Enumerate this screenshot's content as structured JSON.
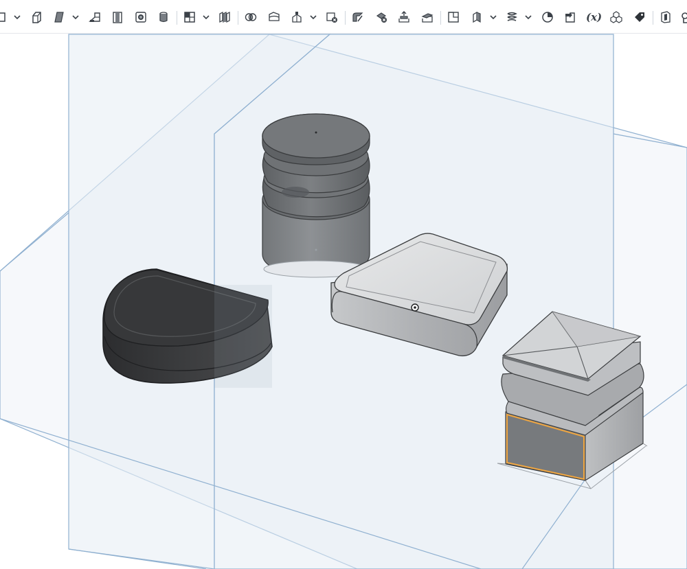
{
  "toolbar": {
    "items": [
      {
        "name": "sketch-tool",
        "icon": "sketch-icon"
      },
      {
        "name": "extrude-tool",
        "icon": "extrude-icon"
      },
      {
        "name": "revolve-tool",
        "icon": "revolve-icon"
      },
      {
        "name": "sweep-tool",
        "icon": "sweep-icon"
      },
      {
        "name": "loft-tool",
        "icon": "loft-icon"
      },
      {
        "name": "thicken-tool",
        "icon": "thicken-icon"
      },
      {
        "name": "enclose-tool",
        "icon": "enclose-icon"
      },
      {
        "name": "fillet-tool",
        "icon": "fillet-icon"
      },
      {
        "name": "chamfer-tool",
        "icon": "chamfer-icon"
      },
      {
        "name": "draft-tool",
        "icon": "draft-icon"
      },
      {
        "name": "rib-tool",
        "icon": "rib-icon"
      },
      {
        "name": "shell-tool",
        "icon": "shell-icon"
      },
      {
        "name": "hole-tool",
        "icon": "hole-icon"
      },
      {
        "name": "boolean-tool",
        "icon": "boolean-icon"
      },
      {
        "name": "split-tool",
        "icon": "split-icon"
      },
      {
        "name": "transform-tool",
        "icon": "transform-icon"
      },
      {
        "name": "delete-part-tool",
        "icon": "delete-part-icon"
      },
      {
        "name": "modify-fillet-tool",
        "icon": "modify-fillet-icon"
      },
      {
        "name": "delete-face-tool",
        "icon": "delete-face-icon"
      },
      {
        "name": "move-face-tool",
        "icon": "move-face-icon"
      },
      {
        "name": "replace-face-tool",
        "icon": "replace-face-icon"
      },
      {
        "name": "plane-tool",
        "icon": "plane-icon"
      },
      {
        "name": "mate-connector-tool",
        "icon": "mate-connector-icon"
      },
      {
        "name": "helix-tool",
        "icon": "helix-icon"
      },
      {
        "name": "measure-tool",
        "icon": "measure-icon"
      },
      {
        "name": "import-tool",
        "icon": "import-icon"
      },
      {
        "name": "variable-tool",
        "icon": "variable-icon"
      },
      {
        "name": "assembly-tool",
        "icon": "assembly-icon"
      },
      {
        "name": "tag-tool",
        "icon": "tag-icon"
      },
      {
        "name": "section-view-tool",
        "icon": "section-view-icon"
      },
      {
        "name": "more-tool",
        "icon": "more-icon"
      }
    ],
    "variable_label": "(x)"
  },
  "viewport": {
    "background": "#ffffff",
    "plane_fill": "#e9f0f6",
    "plane_edge": "#8fb0d0",
    "selection_color": "#f0a640",
    "parts": [
      {
        "name": "half-round-puck",
        "color": "#3c3d3f"
      },
      {
        "name": "ribbed-cylinder",
        "color": "#6f7275"
      },
      {
        "name": "rounded-wedge-box",
        "color": "#c9cbcd"
      },
      {
        "name": "square-pedestal-cap",
        "color": "#b7b9bb"
      }
    ]
  }
}
